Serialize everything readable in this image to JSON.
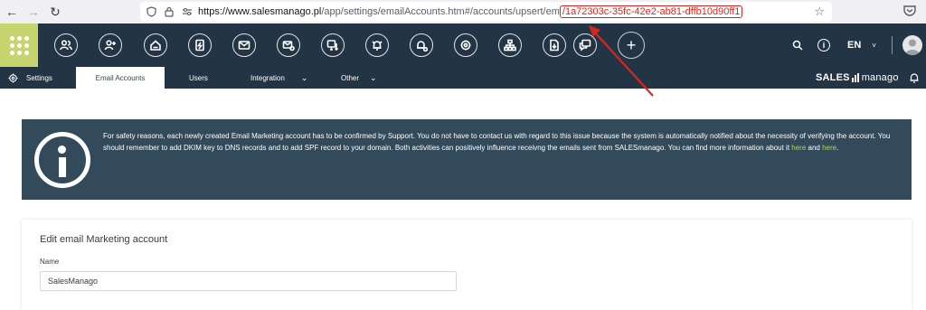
{
  "browser": {
    "url_host": "https://www.salesmanago.pl",
    "url_path": "/app/settings/emailAccounts.htm#/accounts/upsert/em",
    "url_highlight": "/1a72303c-35fc-42e2-ab81-dffb10d90ff1"
  },
  "toolbar": {
    "icons": [
      "contacts-icon",
      "add-contact-icon",
      "home-icon",
      "automation-icon",
      "email-icon",
      "email-marketing-icon",
      "web-push-icon",
      "notification-icon",
      "mobile-notification-icon",
      "settings-wheel-icon",
      "hierarchy-icon",
      "file-download-icon",
      "chat-icon"
    ],
    "language": "EN",
    "accent_color": "#c7d56f",
    "bar_color": "#233545"
  },
  "subnav": {
    "settings": "Settings",
    "email_accounts": "Email Accounts",
    "users": "Users",
    "integration": "Integration",
    "other": "Other",
    "brand_bold": "SALES",
    "brand_light": "manago"
  },
  "notice": {
    "text_before": "For safety reasons, each newly created Email Marketing account has to be confirmed by Support. You do not have to contact us with regard to this issue because the system is automatically notified about the necessity of verifying the account. You should remember to add DKIM key to DNS records and to add SPF record to your domain. Both activities can positively influence receivng the emails sent from SALESmanago. You can find more information about it ",
    "link1": "here",
    "and": " and ",
    "link2": "here",
    "end": ".",
    "background": "#324a5a",
    "link_color": "#b9d45a"
  },
  "form": {
    "title": "Edit email Marketing account",
    "name_label": "Name",
    "name_value": "SalesManago"
  },
  "annotation": {
    "color": "#d9261c"
  }
}
